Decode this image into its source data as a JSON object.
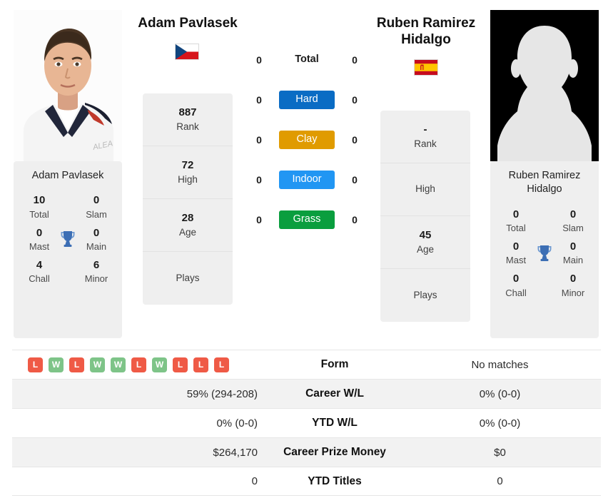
{
  "players": {
    "left": {
      "name": "Adam Pavlasek",
      "photo_caption": "Adam Pavlasek",
      "flag": "czech-republic-flag",
      "trophies": {
        "total": "10",
        "total_label": "Total",
        "slam": "0",
        "slam_label": "Slam",
        "mast": "0",
        "mast_label": "Mast",
        "main": "0",
        "main_label": "Main",
        "chall": "4",
        "chall_label": "Chall",
        "minor": "6",
        "minor_label": "Minor"
      },
      "stats": [
        {
          "value": "887",
          "label": "Rank"
        },
        {
          "value": "72",
          "label": "High"
        },
        {
          "value": "28",
          "label": "Age"
        },
        {
          "value": "",
          "label": "Plays"
        }
      ]
    },
    "right": {
      "name": "Ruben Ramirez Hidalgo",
      "photo_caption": "Ruben Ramirez Hidalgo",
      "flag": "spain-flag",
      "trophies": {
        "total": "0",
        "total_label": "Total",
        "slam": "0",
        "slam_label": "Slam",
        "mast": "0",
        "mast_label": "Mast",
        "main": "0",
        "main_label": "Main",
        "chall": "0",
        "chall_label": "Chall",
        "minor": "0",
        "minor_label": "Minor"
      },
      "stats": [
        {
          "value": "-",
          "label": "Rank"
        },
        {
          "value": "",
          "label": "High"
        },
        {
          "value": "45",
          "label": "Age"
        },
        {
          "value": "",
          "label": "Plays"
        }
      ]
    }
  },
  "surfaces": [
    {
      "label": "Total",
      "left": "0",
      "right": "0",
      "color": "none",
      "style": "plain"
    },
    {
      "label": "Hard",
      "left": "0",
      "right": "0",
      "color": "#0a6cc4",
      "style": "badge"
    },
    {
      "label": "Clay",
      "left": "0",
      "right": "0",
      "color": "#e09b00",
      "style": "badge"
    },
    {
      "label": "Indoor",
      "left": "0",
      "right": "0",
      "color": "#2196f3",
      "style": "badge"
    },
    {
      "label": "Grass",
      "left": "0",
      "right": "0",
      "color": "#0a9e3e",
      "style": "badge"
    }
  ],
  "comparison": [
    {
      "label": "Form",
      "left": "",
      "right": "No matches",
      "left_type": "form"
    },
    {
      "label": "Career W/L",
      "left": "59% (294-208)",
      "right": "0% (0-0)",
      "left_type": "text"
    },
    {
      "label": "YTD W/L",
      "left": "0% (0-0)",
      "right": "0% (0-0)",
      "left_type": "text"
    },
    {
      "label": "Career Prize Money",
      "left": "$264,170",
      "right": "$0",
      "left_type": "text"
    },
    {
      "label": "YTD Titles",
      "left": "0",
      "right": "0",
      "left_type": "text"
    }
  ],
  "form_badges": [
    {
      "result": "L"
    },
    {
      "result": "W"
    },
    {
      "result": "L"
    },
    {
      "result": "W"
    },
    {
      "result": "W"
    },
    {
      "result": "L"
    },
    {
      "result": "W"
    },
    {
      "result": "L"
    },
    {
      "result": "L"
    },
    {
      "result": "L"
    }
  ],
  "colors": {
    "loss": "#ef5a46",
    "win": "#7ec488",
    "trophy": "#3c6eb4",
    "card_bg": "#efefef",
    "row_alt": "#f2f2f2"
  }
}
